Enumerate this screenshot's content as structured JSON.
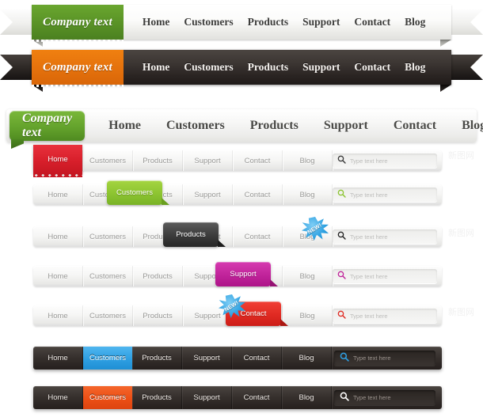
{
  "brand": {
    "text": "Company text"
  },
  "nav_links": [
    "Home",
    "Customers",
    "Products",
    "Support",
    "Contact",
    "Blog"
  ],
  "search": {
    "placeholder": "Type text here",
    "icon": "search-icon"
  },
  "badge": {
    "label": "NEW!"
  },
  "ribbon_light": {
    "style": "light-ribbon",
    "brand": "Company text",
    "brand_color": "#5d9726",
    "links": [
      "Home",
      "Customers",
      "Products",
      "Support",
      "Contact",
      "Blog"
    ]
  },
  "ribbon_dark": {
    "style": "dark-ribbon",
    "brand": "Company text",
    "brand_color": "#e3700c",
    "links": [
      "Home",
      "Customers",
      "Products",
      "Support",
      "Contact",
      "Blog"
    ]
  },
  "bar_big": {
    "brand": "Company text",
    "brand_color": "#64a32c",
    "links": [
      "Home",
      "Customers",
      "Products",
      "Support",
      "Contact",
      "Blog"
    ]
  },
  "bars_light": [
    {
      "active": "Home",
      "active_color": "#d81f2b",
      "magnifier_color": "#3a3a3a",
      "items": [
        "Home",
        "Customers",
        "Products",
        "Support",
        "Contact",
        "Blog"
      ],
      "placeholder": "Type text here",
      "badge": null
    },
    {
      "active": "Customers",
      "active_color": "#8cc431",
      "magnifier_color": "#8cc431",
      "items": [
        "Home",
        "Customers",
        "Products",
        "Support",
        "Contact",
        "Blog"
      ],
      "placeholder": "Type text here",
      "badge": null
    },
    {
      "active": "Products",
      "active_color": "#3b3b3b",
      "magnifier_color": "#222222",
      "items": [
        "Home",
        "Customers",
        "Products",
        "Support",
        "Contact",
        "Blog"
      ],
      "placeholder": "Type text here",
      "badge": "NEW!"
    },
    {
      "active": "Support",
      "active_color": "#c0239a",
      "magnifier_color": "#c0239a",
      "items": [
        "Home",
        "Customers",
        "Products",
        "Support",
        "Contact",
        "Blog"
      ],
      "placeholder": "Type text here",
      "badge": null
    },
    {
      "active": "Contact",
      "active_color": "#e02a22",
      "magnifier_color": "#e02a22",
      "items": [
        "Home",
        "Customers",
        "Products",
        "Support",
        "Contact",
        "Blog"
      ],
      "placeholder": "Type text here",
      "badge": "NEW!"
    }
  ],
  "bars_dark": [
    {
      "active": "Customers",
      "active_color": "#2e9fe2",
      "magnifier_color": "#2e9fe2",
      "items": [
        "Home",
        "Customers",
        "Products",
        "Support",
        "Contact",
        "Blog"
      ],
      "placeholder": "Type text here"
    },
    {
      "active": "Customers",
      "active_color": "#ec4f15",
      "magnifier_color": "#ffffff",
      "items": [
        "Home",
        "Customers",
        "Products",
        "Support",
        "Contact",
        "Blog"
      ],
      "placeholder": "Type text here"
    }
  ],
  "watermark": {
    "text": "新图网"
  }
}
